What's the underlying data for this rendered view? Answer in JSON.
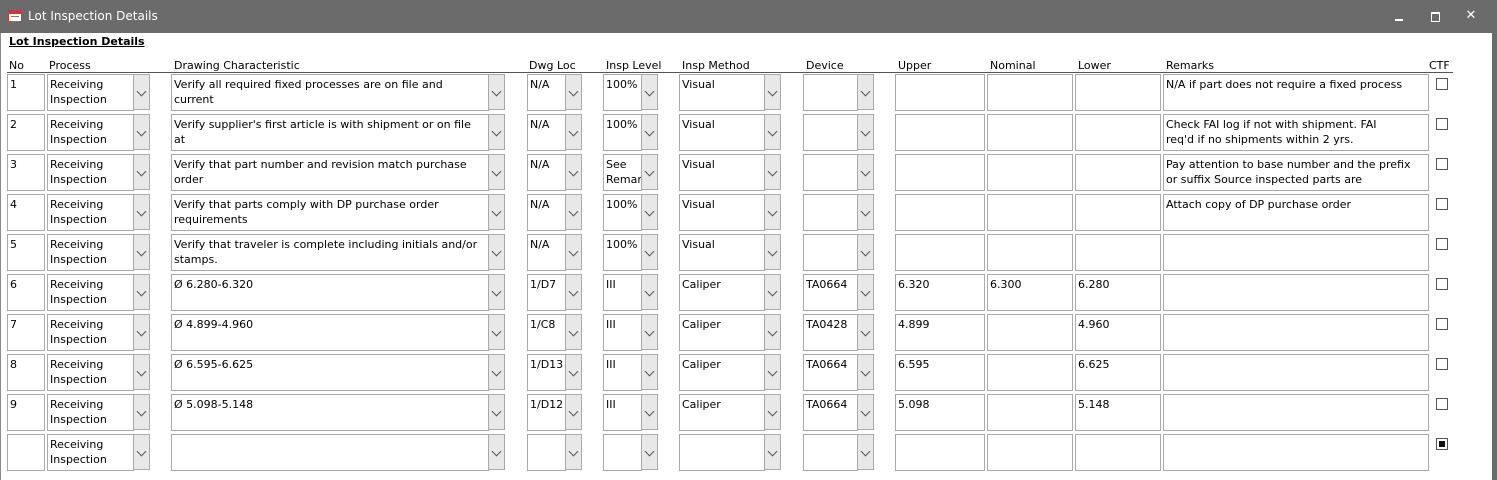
{
  "window": {
    "title": "Lot Inspection Details"
  },
  "form": {
    "title": "Lot Inspection Details"
  },
  "columns": {
    "no": "No",
    "process": "Process",
    "drawing": "Drawing Characteristic",
    "dwg_loc": "Dwg Loc",
    "insp_level": "Insp Level",
    "insp_method": "Insp Method",
    "device": "Device",
    "upper": "Upper",
    "nominal": "Nominal",
    "lower": "Lower",
    "remarks": "Remarks",
    "ctf": "CTF"
  },
  "rows": [
    {
      "no": "1",
      "process": "Receiving\nInspection",
      "drawing": "Verify all required fixed processes are on file and current",
      "dwg_loc": "N/A",
      "insp_level": "100%",
      "insp_method": "Visual",
      "device": "",
      "upper": "",
      "nominal": "",
      "lower": "",
      "remarks": "N/A if part does not require a fixed process",
      "ctf": false
    },
    {
      "no": "2",
      "process": "Receiving\nInspection",
      "drawing": "Verify supplier's first article is with shipment or on file at\nDP.",
      "dwg_loc": "N/A",
      "insp_level": "100%",
      "insp_method": "Visual",
      "device": "",
      "upper": "",
      "nominal": "",
      "lower": "",
      "remarks": "Check FAI log if not with shipment.  FAI\nreq'd if no shipments within 2 yrs.",
      "ctf": false
    },
    {
      "no": "3",
      "process": "Receiving\nInspection",
      "drawing": "Verify that part number and revision match purchase order\nand approved design data",
      "dwg_loc": "N/A",
      "insp_level": "See\nRemarks",
      "insp_method": "Visual",
      "device": "",
      "upper": "",
      "nominal": "",
      "lower": "",
      "remarks": "Pay attention to base number and the prefix\nor suffix Source inspected parts are",
      "ctf": false
    },
    {
      "no": "4",
      "process": "Receiving\nInspection",
      "drawing": "Verify that parts comply with DP purchase order\nrequirements",
      "dwg_loc": "N/A",
      "insp_level": "100%",
      "insp_method": "Visual",
      "device": "",
      "upper": "",
      "nominal": "",
      "lower": "",
      "remarks": "Attach copy of DP purchase order",
      "ctf": false
    },
    {
      "no": "5",
      "process": "Receiving\nInspection",
      "drawing": "Verify that traveler is complete including initials and/or\nstamps.",
      "dwg_loc": "N/A",
      "insp_level": "100%",
      "insp_method": "Visual",
      "device": "",
      "upper": "",
      "nominal": "",
      "lower": "",
      "remarks": "",
      "ctf": false
    },
    {
      "no": "6",
      "process": "Receiving\nInspection",
      "drawing": "Ø 6.280-6.320",
      "dwg_loc": "1/D7",
      "insp_level": "III",
      "insp_method": "Caliper",
      "device": "TA0664",
      "upper": "6.320",
      "nominal": "6.300",
      "lower": "6.280",
      "remarks": "",
      "ctf": false
    },
    {
      "no": "7",
      "process": "Receiving\nInspection",
      "drawing": "Ø 4.899-4.960",
      "dwg_loc": "1/C8",
      "insp_level": "III",
      "insp_method": "Caliper",
      "device": "TA0428",
      "upper": "4.899",
      "nominal": "",
      "lower": "4.960",
      "remarks": "",
      "ctf": false
    },
    {
      "no": "8",
      "process": "Receiving\nInspection",
      "drawing": "Ø 6.595-6.625",
      "dwg_loc": "1/D13",
      "insp_level": "III",
      "insp_method": "Caliper",
      "device": "TA0664",
      "upper": "6.595",
      "nominal": "",
      "lower": "6.625",
      "remarks": "",
      "ctf": false
    },
    {
      "no": "9",
      "process": "Receiving\nInspection",
      "drawing": "Ø 5.098-5.148",
      "dwg_loc": "1/D12",
      "insp_level": "III",
      "insp_method": "Caliper",
      "device": "TA0664",
      "upper": "5.098",
      "nominal": "",
      "lower": "5.148",
      "remarks": "",
      "ctf": false
    },
    {
      "no": "",
      "process": "Receiving\nInspection",
      "drawing": "",
      "dwg_loc": "",
      "insp_level": "",
      "insp_method": "",
      "device": "",
      "upper": "",
      "nominal": "",
      "lower": "",
      "remarks": "",
      "ctf": true
    }
  ]
}
